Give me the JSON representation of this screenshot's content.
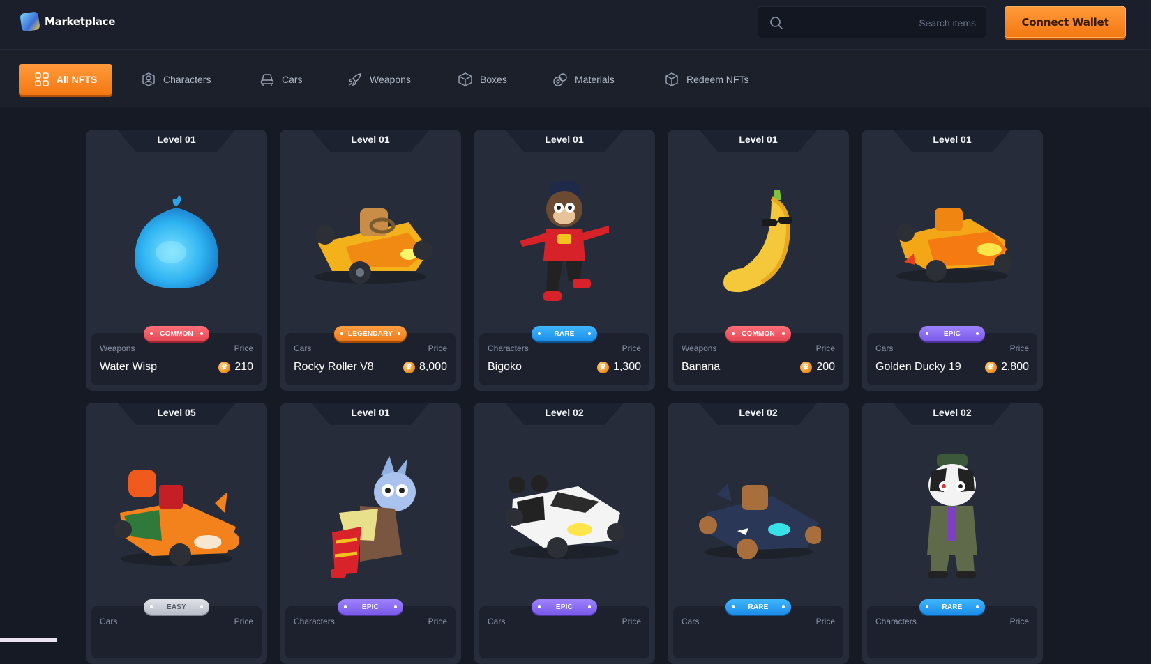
{
  "header": {
    "brand": "Marketplace",
    "search_placeholder": "Search items",
    "connect_label": "Connect Wallet"
  },
  "tabs": [
    {
      "label": "All NFTS",
      "icon": "grid-icon"
    },
    {
      "label": "Characters",
      "icon": "character-icon"
    },
    {
      "label": "Cars",
      "icon": "car-icon"
    },
    {
      "label": "Weapons",
      "icon": "rocket-icon"
    },
    {
      "label": "Boxes",
      "icon": "box-icon"
    },
    {
      "label": "Materials",
      "icon": "materials-icon"
    },
    {
      "label": "Redeem NFTs",
      "icon": "redeem-icon"
    }
  ],
  "price_label": "Price",
  "cards": [
    {
      "level": "Level 01",
      "rarity": "COMMON",
      "rarity_class": "common",
      "category": "Weapons",
      "name": "Water Wisp",
      "price": "210",
      "art": "water-balloon"
    },
    {
      "level": "Level 01",
      "rarity": "LEGENDARY",
      "rarity_class": "legendary",
      "category": "Cars",
      "name": "Rocky Roller V8",
      "price": "8,000",
      "art": "kart-yellow"
    },
    {
      "level": "Level 01",
      "rarity": "RARE",
      "rarity_class": "rare",
      "category": "Characters",
      "name": "Bigoko",
      "price": "1,300",
      "art": "monkey"
    },
    {
      "level": "Level 01",
      "rarity": "COMMON",
      "rarity_class": "common",
      "category": "Weapons",
      "name": "Banana",
      "price": "200",
      "art": "banana"
    },
    {
      "level": "Level 01",
      "rarity": "EPIC",
      "rarity_class": "epic",
      "category": "Cars",
      "name": "Golden Ducky 19",
      "price": "2,800",
      "art": "kart-gold"
    },
    {
      "level": "Level 05",
      "rarity": "EASY",
      "rarity_class": "easy",
      "category": "Cars",
      "name": "",
      "price": "",
      "art": "kart-fox"
    },
    {
      "level": "Level 01",
      "rarity": "EPIC",
      "rarity_class": "epic",
      "category": "Characters",
      "name": "",
      "price": "",
      "art": "wolf"
    },
    {
      "level": "Level 02",
      "rarity": "EPIC",
      "rarity_class": "epic",
      "category": "Cars",
      "name": "",
      "price": "",
      "art": "kart-panda"
    },
    {
      "level": "Level 02",
      "rarity": "RARE",
      "rarity_class": "rare",
      "category": "Cars",
      "name": "",
      "price": "",
      "art": "kart-shark"
    },
    {
      "level": "Level 02",
      "rarity": "RARE",
      "rarity_class": "rare",
      "category": "Characters",
      "name": "",
      "price": "",
      "art": "dog"
    }
  ]
}
